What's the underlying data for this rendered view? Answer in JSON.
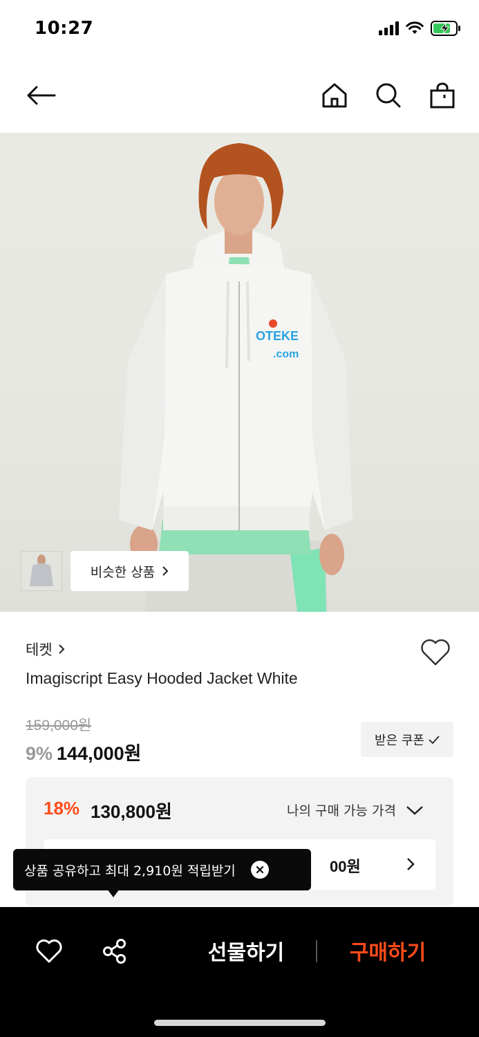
{
  "status_bar": {
    "time": "10:27"
  },
  "nav": {
    "icons": [
      "back-arrow-icon",
      "home-icon",
      "search-icon",
      "shopping-bag-icon"
    ]
  },
  "hero": {
    "similar_label": "비슷한 상품",
    "print": {
      "logo_text": "OTEKE",
      "domain_text": ".com"
    }
  },
  "product": {
    "brand": "테켓",
    "name": "Imagiscript Easy Hooded Jacket White",
    "original_price": "159,000원",
    "discount_rate": "9%",
    "price": "144,000원",
    "coupon_label": "받은 쿠폰"
  },
  "my_price": {
    "discount_rate": "18%",
    "price": "130,800원",
    "label": "나의 구매 가능 가격",
    "inner_value_visible": "00원"
  },
  "tooltip": {
    "text": "상품 공유하고 최대 2,910원 적립받기"
  },
  "bottom_bar": {
    "gift_label": "선물하기",
    "buy_label": "구매하기"
  },
  "colors": {
    "accent": "#ff4b1a",
    "bar": "#000000",
    "box": "#f3f3f3"
  }
}
